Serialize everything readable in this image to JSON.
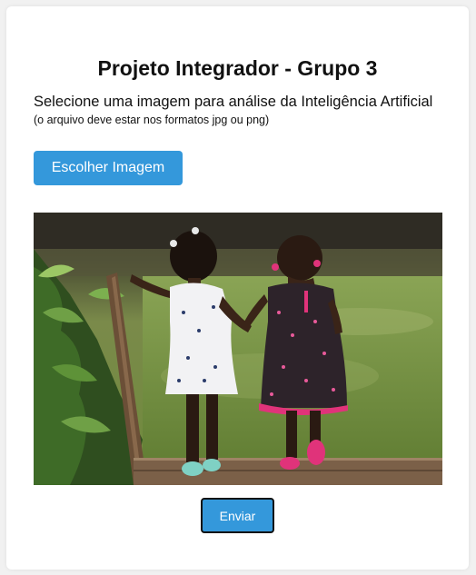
{
  "page": {
    "title": "Projeto Integrador - Grupo 3",
    "instruction": "Selecione uma imagem para análise da Inteligência Artificial",
    "format_hint": "(o arquivo deve estar nos formatos jpg ou png)"
  },
  "upload": {
    "choose_label": "Escolher Imagem"
  },
  "actions": {
    "submit_label": "Enviar"
  },
  "colors": {
    "accent": "#3498db",
    "background": "#f1f1f1",
    "card": "#ffffff"
  }
}
